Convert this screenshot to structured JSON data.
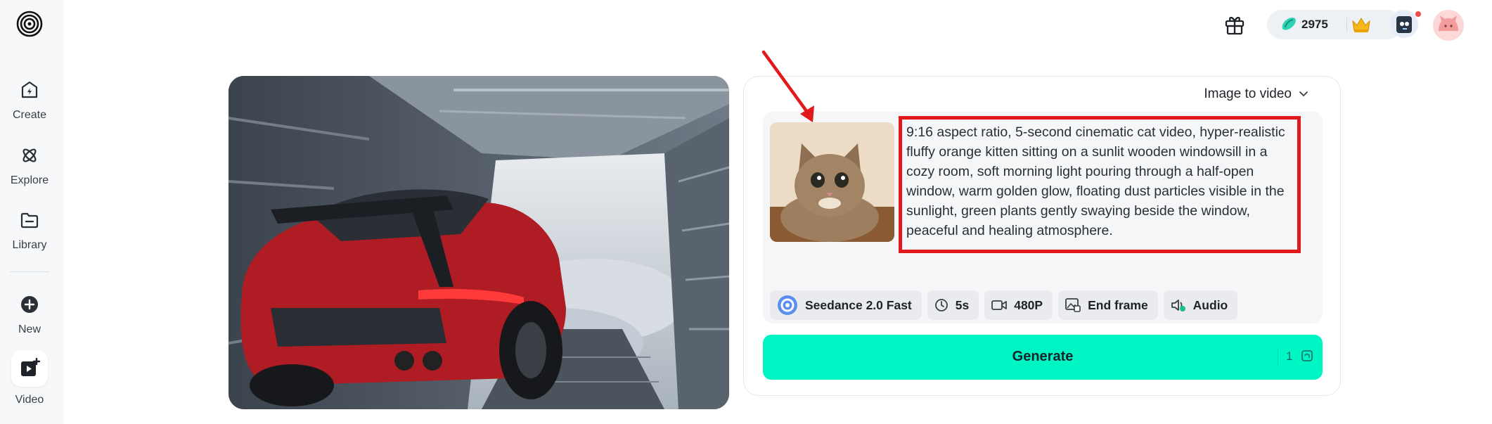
{
  "sidebar": {
    "logo_icon": "spiral-logo-icon",
    "items": [
      {
        "label": "Create",
        "icon": "create-icon"
      },
      {
        "label": "Explore",
        "icon": "explore-icon"
      },
      {
        "label": "Library",
        "icon": "folder-icon"
      },
      {
        "label": "New",
        "icon": "plus-circle-icon"
      },
      {
        "label": "Video",
        "icon": "video-add-icon"
      }
    ]
  },
  "header": {
    "gift_icon": "gift-icon",
    "credits": "2975",
    "crown_icon": "crown-icon"
  },
  "panel": {
    "mode": "Image to video",
    "prompt": "9:16 aspect ratio, 5-second cinematic cat video, hyper-realistic fluffy orange kitten sitting on a sunlit wooden windowsill in a cozy room, soft morning light pouring through a half-open window, warm golden glow, floating dust particles visible in the sunlight, green plants gently swaying beside the window, peaceful and healing atmosphere.",
    "chips": {
      "model": "Seedance 2.0 Fast",
      "duration": "5s",
      "resolution": "480P",
      "end_frame": "End frame",
      "audio": "Audio"
    },
    "generate_label": "Generate",
    "generate_cost": "1"
  },
  "colors": {
    "accent": "#00f5c5",
    "annotation_red": "#e1191d",
    "sidebar_bg": "#f7f8fa"
  }
}
